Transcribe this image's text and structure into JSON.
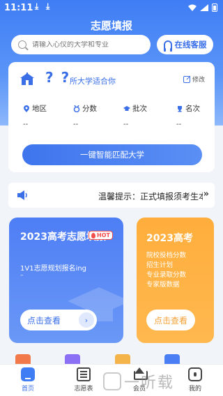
{
  "status_bar": {
    "time": "11:11",
    "download_icon": "download-arrow-icon"
  },
  "header": {
    "title": "志愿填报"
  },
  "search": {
    "placeholder": "请输入心仪的大学和专业",
    "icon": "search-icon"
  },
  "service_button": {
    "label": "在线客服",
    "icon": "headset-icon"
  },
  "info_card": {
    "question_marks": "? ?",
    "fit_text": "所大学适合你",
    "edit_label": "修改",
    "stats": [
      {
        "label": "地区",
        "icon": "location-pin-icon",
        "value": "--"
      },
      {
        "label": "分数",
        "icon": "medal-icon",
        "value": "--"
      },
      {
        "label": "批次",
        "icon": "graduation-cap-icon",
        "value": "--"
      },
      {
        "label": "名次",
        "icon": "trophy-icon",
        "value": "--"
      }
    ],
    "match_button": "一键智能匹配大学"
  },
  "notice": {
    "text": "温馨提示：正式填报须考生本",
    "more": "»"
  },
  "promo_blue": {
    "title": "2023高考志愿填报",
    "badge": "HOT",
    "subtitle": "1V1志愿规划报名ing",
    "dash": "–",
    "button": "点击查看",
    "arrow": "›"
  },
  "promo_orange": {
    "title": "2023高考",
    "lines": [
      "院校投档分数",
      "招生计划",
      "专业录取分数",
      "专家版数据"
    ],
    "button": "点击查看"
  },
  "bottom_nav": [
    {
      "label": "首页",
      "icon": "home-icon",
      "active": true
    },
    {
      "label": "志愿表",
      "icon": "list-icon",
      "active": false
    },
    {
      "label": "会员",
      "icon": "crown-icon",
      "active": false
    },
    {
      "label": "我的",
      "icon": "profile-icon",
      "active": false
    }
  ],
  "watermark": {
    "text": "一听载"
  },
  "colors": {
    "primary": "#3f7df5",
    "orange": "#ffae3c",
    "hot": "#f24e4e"
  }
}
